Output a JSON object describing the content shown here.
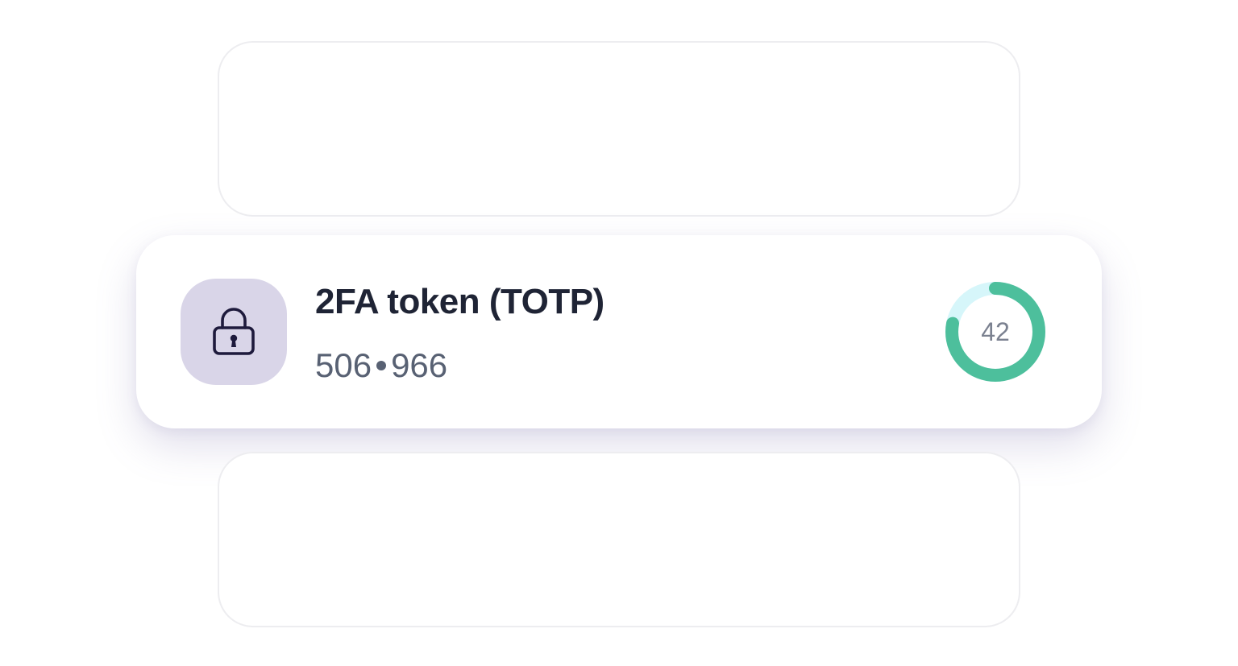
{
  "token": {
    "title": "2FA token (TOTP)",
    "code_first": "506",
    "code_second": "966",
    "icon": "lock-icon"
  },
  "timer": {
    "seconds_remaining": "42",
    "fraction_remaining": 0.78,
    "progress_color": "#4dbf9c",
    "track_color": "#d6f6fa"
  },
  "colors": {
    "icon_tile_bg": "#d9d5e8",
    "icon_stroke": "#1e1a3c",
    "title": "#1f2435",
    "code": "#586173"
  }
}
